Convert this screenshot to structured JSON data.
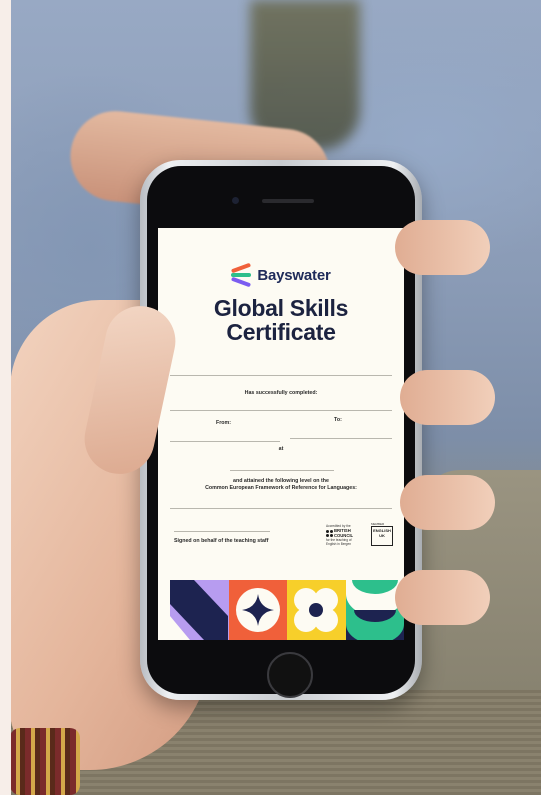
{
  "certificate": {
    "brand": "Bayswater",
    "title_line1": "Global Skills",
    "title_line2": "Certificate",
    "completed_label": "Has successfully completed:",
    "from_label": "From:",
    "to_label": "To:",
    "at_label": "at",
    "attained_line1": "and attained the following level on the",
    "attained_line2": "Common European Framework of Reference for Languages:",
    "signed_label": "Signed on behalf of the teaching staff",
    "accredited_caption": "Accredited by the",
    "british_council_line1": "BRITISH",
    "british_council_line2": "COUNCIL",
    "bc_sub": "for the teaching of English in Bergen",
    "member_caption": "MEMBER",
    "english_uk_line1": "ENGLISH",
    "english_uk_line2": "UK"
  },
  "colors": {
    "brand_navy": "#1f2b5a",
    "tile_purple": "#b79cf0",
    "tile_orange": "#f0603a",
    "tile_yellow": "#f7cf2a",
    "tile_green": "#2dbf8c",
    "tile_navy": "#1d2350"
  }
}
